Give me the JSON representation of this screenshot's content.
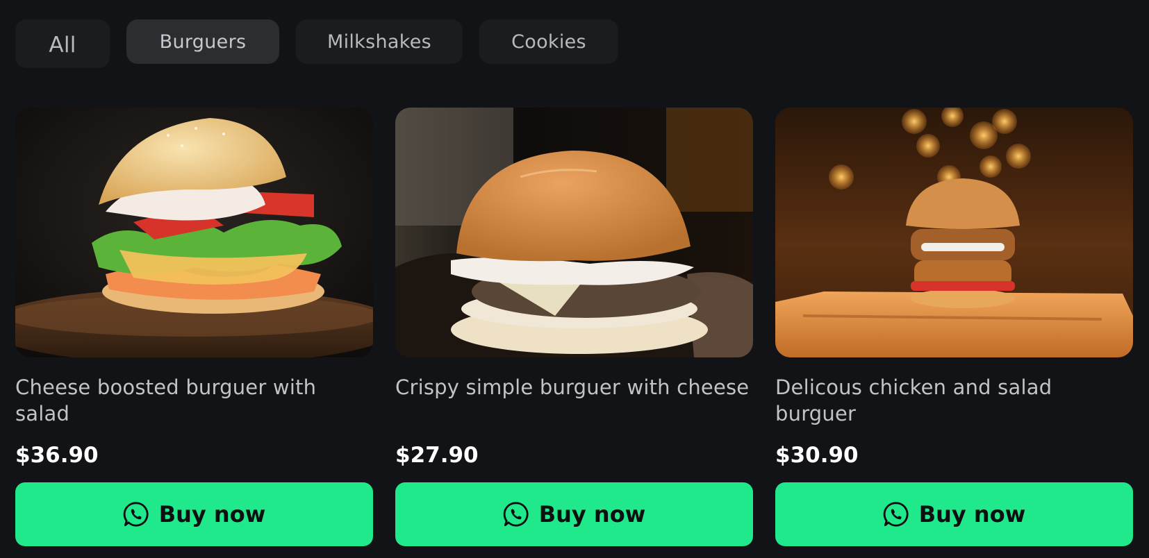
{
  "tabs": [
    {
      "label": "All"
    },
    {
      "label": "Burguers",
      "active": true
    },
    {
      "label": "Milkshakes"
    },
    {
      "label": "Cookies"
    }
  ],
  "products": [
    {
      "title": "Cheese boosted burguer with salad",
      "price": "$36.90",
      "button": "Buy now",
      "image": "burger-photo-cheese-salad"
    },
    {
      "title": "Crispy simple burguer with cheese",
      "price": "$27.90",
      "button": "Buy now",
      "image": "burger-photo-crispy-cheese"
    },
    {
      "title": "Delicous chicken and salad burguer",
      "price": "$30.90",
      "button": "Buy now",
      "image": "burger-photo-chicken-salad"
    }
  ],
  "colors": {
    "background": "#121316",
    "accent": "#1fe98b",
    "tab": "#1b1c1f",
    "tab_active": "#2c2d31"
  },
  "icons": {
    "buy": "whatsapp-icon"
  }
}
